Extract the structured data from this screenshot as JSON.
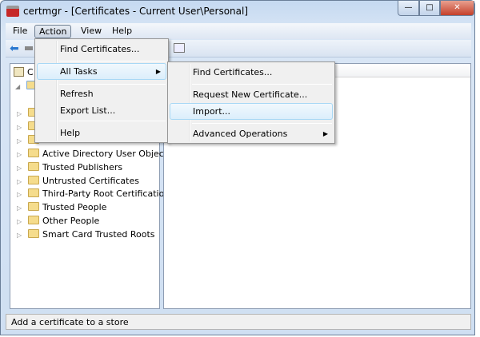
{
  "window": {
    "title": "certmgr - [Certificates - Current User\\Personal]",
    "minimize": "—",
    "maximize": "□",
    "close": "✕"
  },
  "menubar": [
    "File",
    "Action",
    "View",
    "Help"
  ],
  "action_menu": [
    {
      "label": "Find Certificates..."
    },
    {
      "label": "All Tasks",
      "submenu": true
    },
    {
      "label": "Refresh"
    },
    {
      "label": "Export List..."
    },
    {
      "label": "Help"
    }
  ],
  "all_tasks_menu": [
    {
      "label": "Find Certificates..."
    },
    {
      "label": "Request New Certificate..."
    },
    {
      "label": "Import..."
    },
    {
      "label": "Advanced Operations",
      "submenu": true
    }
  ],
  "tree": {
    "root": "C",
    "items": [
      "Active Directory User Object",
      "Trusted Publishers",
      "Untrusted Certificates",
      "Third-Party Root Certification",
      "Trusted People",
      "Other People",
      "Smart Card Trusted Roots"
    ]
  },
  "status": "Add a certificate to a store"
}
